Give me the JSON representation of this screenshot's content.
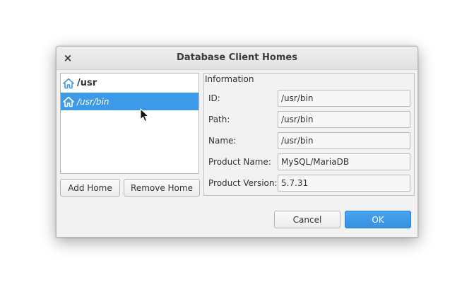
{
  "dialog": {
    "title": "Database Client Homes",
    "close_glyph": "×"
  },
  "homes": [
    {
      "label": "/usr",
      "icon": "home-icon"
    },
    {
      "label": "/usr/bin",
      "icon": "home-icon",
      "selected": true
    }
  ],
  "buttons": {
    "add": "Add Home",
    "remove": "Remove Home",
    "cancel": "Cancel",
    "ok": "OK"
  },
  "info": {
    "legend": "Information",
    "fields": [
      {
        "label": "ID:",
        "value": "/usr/bin"
      },
      {
        "label": "Path:",
        "value": "/usr/bin"
      },
      {
        "label": "Name:",
        "value": "/usr/bin"
      },
      {
        "label": "Product Name:",
        "value": "MySQL/MariaDB"
      },
      {
        "label": "Product Version:",
        "value": "5.7.31"
      }
    ]
  },
  "colors": {
    "accent": "#3d9ae8",
    "dialog_bg": "#f2f2f2"
  }
}
